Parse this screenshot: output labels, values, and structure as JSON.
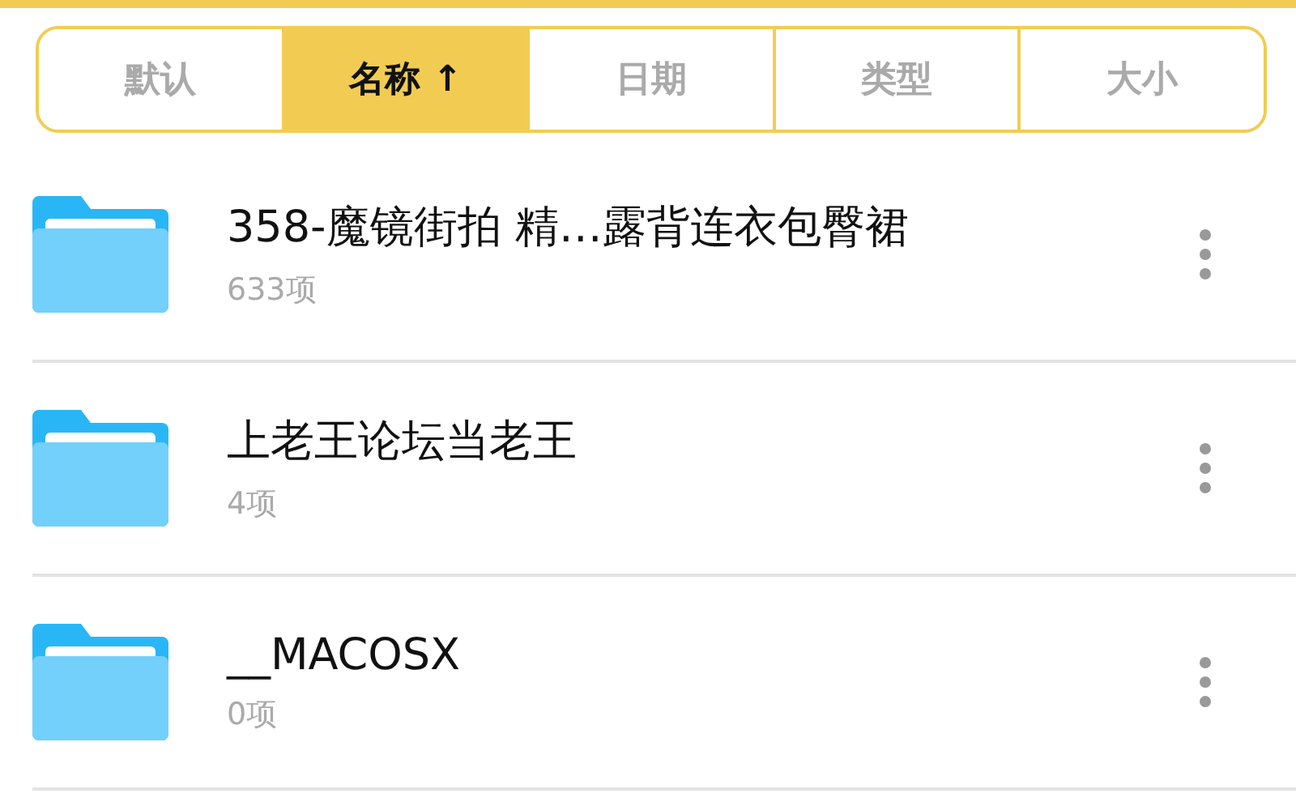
{
  "sort_tabs": [
    {
      "label": "默认",
      "selected": false
    },
    {
      "label": "名称 ↑",
      "selected": true
    },
    {
      "label": "日期",
      "selected": false
    },
    {
      "label": "类型",
      "selected": false
    },
    {
      "label": "大小",
      "selected": false
    }
  ],
  "files": [
    {
      "name": "358-魔镜街拍 精…露背连衣包臀裙",
      "count": "633项"
    },
    {
      "name": "上老王论坛当老王",
      "count": "4项"
    },
    {
      "name": "__MACOSX",
      "count": "0项"
    }
  ]
}
